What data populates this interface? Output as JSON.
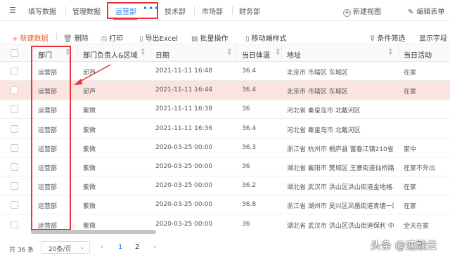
{
  "tabs": [
    "填写数据",
    "管理数据",
    "运营部",
    "技术部",
    "市场部",
    "财务部"
  ],
  "tab_active_more": "•••",
  "header_actions": {
    "new_view": "新建视图",
    "edit_form": "编辑表单"
  },
  "toolbar": {
    "new_data": "+ 新建数据",
    "delete": "删除",
    "print": "打印",
    "export": "导出Excel",
    "batch": "批量操作",
    "mobile_style": "移动端样式",
    "filter": "条件筛选",
    "fields": "显示字段"
  },
  "columns": [
    "部门",
    "部门负责人&区域",
    "日期",
    "当日体温",
    "地址",
    "当日活动"
  ],
  "rows": [
    {
      "dept": "运营部",
      "owner": "邱芦",
      "date": "2021-11-11 16:48",
      "temp": "36.4",
      "addr": "北京市 市辖区 东城区",
      "act": "在家"
    },
    {
      "dept": "运营部",
      "owner": "邱芦",
      "date": "2021-11-11 16:44",
      "temp": "36.4",
      "addr": "北京市 市辖区 东城区",
      "act": "在家"
    },
    {
      "dept": "运营部",
      "owner": "紫微",
      "date": "2021-11-11 16:38",
      "temp": "36",
      "addr": "河北省 秦皇岛市 北戴河区",
      "act": ""
    },
    {
      "dept": "运营部",
      "owner": "紫微",
      "date": "2021-11-11 16:36",
      "temp": "36.4",
      "addr": "河北省 秦皇岛市 北戴河区",
      "act": ""
    },
    {
      "dept": "运营部",
      "owner": "紫微",
      "date": "2020-03-25 00:00",
      "temp": "36.3",
      "addr": "浙江省 杭州市 桐庐县 富春江镇210省道",
      "act": "家中"
    },
    {
      "dept": "运营部",
      "owner": "紫微",
      "date": "2020-03-25 00:00",
      "temp": "36",
      "addr": "湖北省 襄阳市 樊城区 王寨街道仙桥路",
      "act": "在家不外出"
    },
    {
      "dept": "运营部",
      "owner": "紫微",
      "date": "2020-03-25 00:00",
      "temp": "36.2",
      "addr": "湖北省 武汉市 洪山区洪山街道金地格...",
      "act": "在家"
    },
    {
      "dept": "运营部",
      "owner": "紫微",
      "date": "2020-03-25 00:00",
      "temp": "36.8",
      "addr": "浙江省 湖州市 吴兴区凤凰街道青塘一路...",
      "act": "在家"
    },
    {
      "dept": "运营部",
      "owner": "紫微",
      "date": "2020-03-25 00:00",
      "temp": "36",
      "addr": "湖北省 武汉市 洪山区洪山街道保利 中...",
      "act": "全天在家"
    }
  ],
  "pagination": {
    "total": "共 36 条",
    "page_size": "20条/页",
    "pages": [
      "1",
      "2"
    ],
    "current": "1"
  },
  "watermark": "头条 @速融云",
  "colors": {
    "accent": "#1f7cf5",
    "highlight": "#e8343a",
    "row_highlight": "#fbe4df",
    "primary_action": "#e8622f"
  }
}
